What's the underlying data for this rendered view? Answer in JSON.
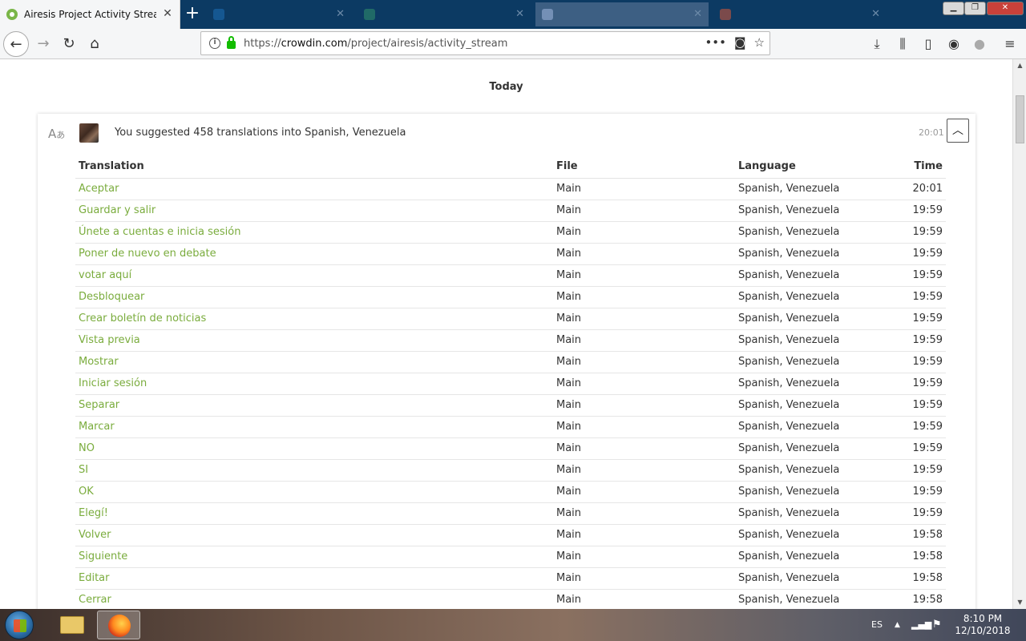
{
  "browser": {
    "active_tab_title": "Airesis Project Activity Stream",
    "url_domain": "crowdin.com",
    "url_prefix": "https://",
    "url_path": "/project/airesis/activity_stream"
  },
  "activity": {
    "day_header": "Today",
    "summary": "You suggested 458 translations into Spanish, Venezuela",
    "time": "20:01",
    "columns": [
      "Translation",
      "File",
      "Language",
      "Time"
    ],
    "rows": [
      {
        "translation": "Aceptar",
        "file": "Main",
        "language": "Spanish, Venezuela",
        "time": "20:01"
      },
      {
        "translation": "Guardar y salir",
        "file": "Main",
        "language": "Spanish, Venezuela",
        "time": "19:59"
      },
      {
        "translation": "Únete a cuentas e inicia sesión",
        "file": "Main",
        "language": "Spanish, Venezuela",
        "time": "19:59"
      },
      {
        "translation": "Poner de nuevo en debate",
        "file": "Main",
        "language": "Spanish, Venezuela",
        "time": "19:59"
      },
      {
        "translation": "votar aquí",
        "file": "Main",
        "language": "Spanish, Venezuela",
        "time": "19:59"
      },
      {
        "translation": "Desbloquear",
        "file": "Main",
        "language": "Spanish, Venezuela",
        "time": "19:59"
      },
      {
        "translation": "Crear boletín de noticias",
        "file": "Main",
        "language": "Spanish, Venezuela",
        "time": "19:59"
      },
      {
        "translation": "Vista previa",
        "file": "Main",
        "language": "Spanish, Venezuela",
        "time": "19:59"
      },
      {
        "translation": "Mostrar",
        "file": "Main",
        "language": "Spanish, Venezuela",
        "time": "19:59"
      },
      {
        "translation": "Iniciar sesión",
        "file": "Main",
        "language": "Spanish, Venezuela",
        "time": "19:59"
      },
      {
        "translation": "Separar",
        "file": "Main",
        "language": "Spanish, Venezuela",
        "time": "19:59"
      },
      {
        "translation": "Marcar",
        "file": "Main",
        "language": "Spanish, Venezuela",
        "time": "19:59"
      },
      {
        "translation": "NO",
        "file": "Main",
        "language": "Spanish, Venezuela",
        "time": "19:59"
      },
      {
        "translation": "SI",
        "file": "Main",
        "language": "Spanish, Venezuela",
        "time": "19:59"
      },
      {
        "translation": "OK",
        "file": "Main",
        "language": "Spanish, Venezuela",
        "time": "19:59"
      },
      {
        "translation": "Elegí!",
        "file": "Main",
        "language": "Spanish, Venezuela",
        "time": "19:59"
      },
      {
        "translation": "Volver",
        "file": "Main",
        "language": "Spanish, Venezuela",
        "time": "19:58"
      },
      {
        "translation": "Siguiente",
        "file": "Main",
        "language": "Spanish, Venezuela",
        "time": "19:58"
      },
      {
        "translation": "Editar",
        "file": "Main",
        "language": "Spanish, Venezuela",
        "time": "19:58"
      },
      {
        "translation": "Cerrar",
        "file": "Main",
        "language": "Spanish, Venezuela",
        "time": "19:58"
      }
    ]
  },
  "taskbar": {
    "language": "ES",
    "time": "8:10 PM",
    "date": "12/10/2018"
  },
  "colors": {
    "link_green": "#7aac3d",
    "tabbar_blue": "#0c3a63"
  }
}
